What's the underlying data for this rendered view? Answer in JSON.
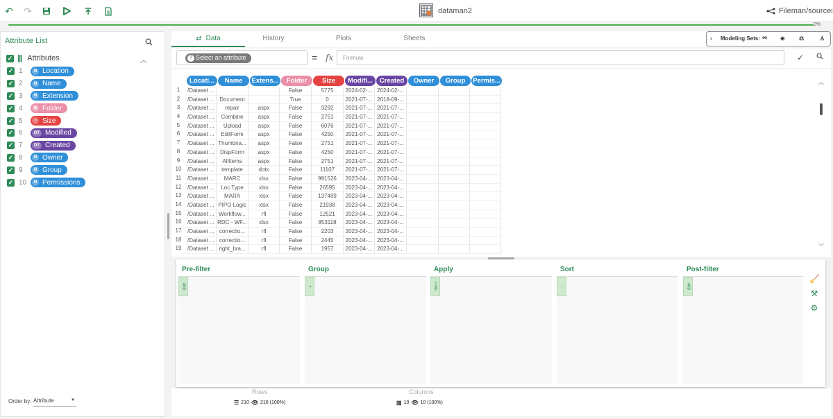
{
  "toolbar": {
    "app_name": "dataman2",
    "project_path": "Fileman/sourceinfo",
    "progress_label": "0%",
    "icons": [
      "undo-icon",
      "redo-icon",
      "save-icon",
      "run-icon",
      "export-icon",
      "document-icon"
    ]
  },
  "left_panel": {
    "title": "Attribute List",
    "root_label": "Attributes",
    "attributes": [
      {
        "num": "1",
        "label": "Location",
        "badge": "N",
        "color": "#2f8fd9"
      },
      {
        "num": "2",
        "label": "Name",
        "badge": "N",
        "color": "#2f8fd9"
      },
      {
        "num": "3",
        "label": "Extension",
        "badge": "N",
        "color": "#2f8fd9"
      },
      {
        "num": "4",
        "label": "Folder",
        "badge": "B",
        "color": "#ec8fa8"
      },
      {
        "num": "5",
        "label": "Size",
        "badge": "I",
        "color": "#e54242"
      },
      {
        "num": "6",
        "label": "Modified",
        "badge": "DT",
        "color": "#6a46a3"
      },
      {
        "num": "7",
        "label": "Created",
        "badge": "DT",
        "color": "#6a46a3"
      },
      {
        "num": "8",
        "label": "Owner",
        "badge": "N",
        "color": "#2f8fd9"
      },
      {
        "num": "9",
        "label": "Group",
        "badge": "N",
        "color": "#2f8fd9"
      },
      {
        "num": "10",
        "label": "Permissions",
        "badge": "N",
        "color": "#2f8fd9"
      }
    ],
    "order_by_label": "Order by:",
    "order_by_value": "Attribute"
  },
  "tabs": [
    {
      "label": "Data",
      "active": true
    },
    {
      "label": "History",
      "active": false
    },
    {
      "label": "Plots",
      "active": false
    },
    {
      "label": "Sheets",
      "active": false
    }
  ],
  "modeling_sets_label": "Modeling Sets:",
  "formula_bar": {
    "select_placeholder": "Select an attribute",
    "equals": "=",
    "fx": "fx",
    "formula_placeholder": "Formula"
  },
  "grid": {
    "columns": [
      {
        "label": "Locati...",
        "color": "#2f8fd9"
      },
      {
        "label": "Name",
        "color": "#2f8fd9"
      },
      {
        "label": "Extens...",
        "color": "#2f8fd9"
      },
      {
        "label": "Folder",
        "color": "#ec8fa8"
      },
      {
        "label": "Size",
        "color": "#e54242"
      },
      {
        "label": "Modifi...",
        "color": "#6a46a3"
      },
      {
        "label": "Created",
        "color": "#6a46a3"
      },
      {
        "label": "Owner",
        "color": "#2f8fd9"
      },
      {
        "label": "Group",
        "color": "#2f8fd9"
      },
      {
        "label": "Permis...",
        "color": "#2f8fd9"
      }
    ],
    "rows": [
      [
        "1",
        "/Dataset ...",
        "",
        "",
        "False",
        "5775",
        "2024-02-...",
        "2024-02-...",
        "",
        "",
        ""
      ],
      [
        "2",
        "/Dataset ...",
        "Document",
        "",
        "True",
        "0",
        "2021-07-...",
        "2018-09-...",
        "",
        "",
        ""
      ],
      [
        "3",
        "/Dataset ...",
        "repair",
        "aspx",
        "False",
        "3292",
        "2021-07-...",
        "2021-07-...",
        "",
        "",
        ""
      ],
      [
        "4",
        "/Dataset ...",
        "Combine",
        "aspx",
        "False",
        "2751",
        "2021-07-...",
        "2021-07-...",
        "",
        "",
        ""
      ],
      [
        "5",
        "/Dataset ...",
        "Upload",
        "aspx",
        "False",
        "6076",
        "2021-07-...",
        "2021-07-...",
        "",
        "",
        ""
      ],
      [
        "6",
        "/Dataset ...",
        "EditForm",
        "aspx",
        "False",
        "4250",
        "2021-07-...",
        "2021-07-...",
        "",
        "",
        ""
      ],
      [
        "7",
        "/Dataset ...",
        "Thumbna...",
        "aspx",
        "False",
        "2751",
        "2021-07-...",
        "2021-07-...",
        "",
        "",
        ""
      ],
      [
        "8",
        "/Dataset ...",
        "DispForm",
        "aspx",
        "False",
        "4250",
        "2021-07-...",
        "2021-07-...",
        "",
        "",
        ""
      ],
      [
        "9",
        "/Dataset ...",
        "AllItems",
        "aspx",
        "False",
        "2751",
        "2021-07-...",
        "2021-07-...",
        "",
        "",
        ""
      ],
      [
        "10",
        "/Dataset ...",
        "template",
        "dotx",
        "False",
        "11107",
        "2021-07-...",
        "2021-07-...",
        "",
        "",
        ""
      ],
      [
        "11",
        "/Dataset ...",
        "MARC",
        "xlsx",
        "False",
        "991526",
        "2023-04-...",
        "2023-04-...",
        "",
        "",
        ""
      ],
      [
        "12",
        "/Dataset ...",
        "Loc Type",
        "xlsx",
        "False",
        "26595",
        "2023-04-...",
        "2023-04-...",
        "",
        "",
        ""
      ],
      [
        "13",
        "/Dataset ...",
        "MARA",
        "xlsx",
        "False",
        "137499",
        "2023-04-...",
        "2023-04-...",
        "",
        "",
        ""
      ],
      [
        "14",
        "/Dataset ...",
        "PIPO Logic",
        "xlsx",
        "False",
        "21938",
        "2023-04-...",
        "2023-04-...",
        "",
        "",
        ""
      ],
      [
        "15",
        "/Dataset ...",
        "Workflow...",
        "rfl",
        "False",
        "12521",
        "2023-04-...",
        "2023-04-...",
        "",
        "",
        ""
      ],
      [
        "16",
        "/Dataset ...",
        "RDC - WF...",
        "xlsx",
        "False",
        "853118",
        "2023-04-...",
        "2023-04-...",
        "",
        "",
        ""
      ],
      [
        "17",
        "/Dataset ...",
        "correctio...",
        "rfl",
        "False",
        "2203",
        "2023-04-...",
        "2023-04-...",
        "",
        "",
        ""
      ],
      [
        "18",
        "/Dataset ...",
        "correctio...",
        "rfl",
        "False",
        "2445",
        "2023-04-...",
        "2023-04-...",
        "",
        "",
        ""
      ],
      [
        "19",
        "/Dataset ...",
        "right_bra...",
        "rfl",
        "False",
        "1957",
        "2023-04-...",
        "2023-04-...",
        "",
        "",
        ""
      ]
    ]
  },
  "pipeline": {
    "stages": [
      {
        "title": "Pre-filter",
        "tag": "AND"
      },
      {
        "title": "Group",
        "tag": "↱"
      },
      {
        "title": "Apply",
        "tag": "FUNC"
      },
      {
        "title": "Sort",
        "tag": "↑"
      },
      {
        "title": "Post-filter",
        "tag": "AND"
      }
    ]
  },
  "footer": {
    "rows_label": "Rows",
    "rows_total": "210",
    "rows_visible": "210 (100%)",
    "columns_label": "Columns",
    "columns_total": "10",
    "columns_visible": "10 (100%)"
  }
}
